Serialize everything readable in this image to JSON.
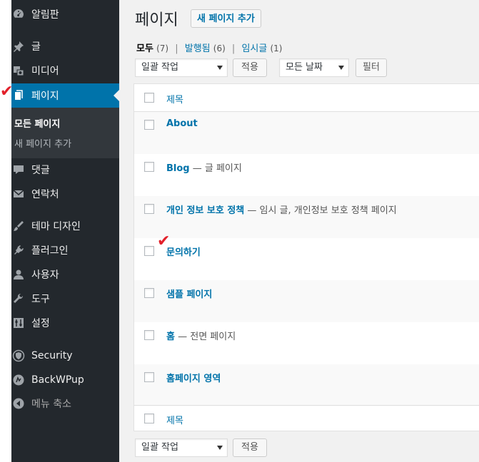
{
  "sidebar": {
    "items": [
      {
        "label": "알림판",
        "icon": "dashboard-icon"
      },
      {
        "label": "글",
        "icon": "pin-icon"
      },
      {
        "label": "미디어",
        "icon": "media-icon"
      },
      {
        "label": "페이지",
        "icon": "page-icon"
      },
      {
        "label": "댓글",
        "icon": "comment-icon"
      },
      {
        "label": "연락처",
        "icon": "mail-icon"
      },
      {
        "label": "테마 디자인",
        "icon": "brush-icon"
      },
      {
        "label": "플러그인",
        "icon": "plugin-icon"
      },
      {
        "label": "사용자",
        "icon": "user-icon"
      },
      {
        "label": "도구",
        "icon": "wrench-icon"
      },
      {
        "label": "설정",
        "icon": "settings-icon"
      },
      {
        "label": "Security",
        "icon": "shield-icon"
      },
      {
        "label": "BackWPup",
        "icon": "backup-icon"
      },
      {
        "label": "메뉴 축소",
        "icon": "collapse-icon"
      }
    ],
    "submenu": [
      {
        "label": "모든 페이지"
      },
      {
        "label": "새 페이지 추가"
      }
    ]
  },
  "main": {
    "title": "페이지",
    "add_new": "새 페이지 추가",
    "filters": {
      "all": "모두",
      "all_count": "(7)",
      "published": "발행됨",
      "published_count": "(6)",
      "draft": "임시글",
      "draft_count": "(1)",
      "sep": "|"
    },
    "bulk_action": "일괄 작업",
    "apply": "적용",
    "date_filter": "모든 날짜",
    "filter_button": "필터",
    "column_title": "제목",
    "rows": [
      {
        "title": "About",
        "state": ""
      },
      {
        "title": "Blog",
        "state": " — 글 페이지"
      },
      {
        "title": "개인 정보 보호 정책",
        "state": " — 임시 글, 개인정보 보호 정책 페이지"
      },
      {
        "title": "문의하기",
        "state": ""
      },
      {
        "title": "샘플 페이지",
        "state": ""
      },
      {
        "title": "홈",
        "state": " — 전면 페이지"
      },
      {
        "title": "홈페이지 영역",
        "state": ""
      }
    ]
  },
  "annotations": {
    "mark": "✔"
  },
  "colors": {
    "sidebar_bg": "#23282d",
    "accent": "#0073aa",
    "check_mark": "#e2202a"
  }
}
